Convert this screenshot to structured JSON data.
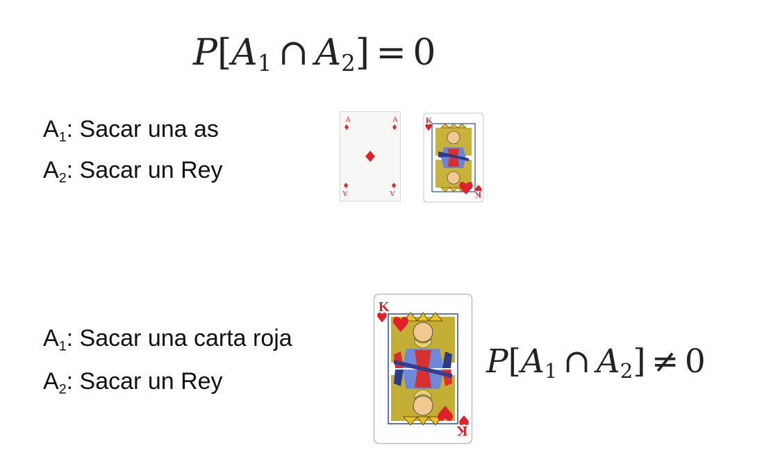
{
  "formulas": {
    "top": {
      "P": "P",
      "lb": "[",
      "A": "A",
      "s1": "1",
      "cap": "∩",
      "s2": "2",
      "rb": "]",
      "rel": "=",
      "rhs": "0"
    },
    "bottom": {
      "P": "P",
      "lb": "[",
      "A": "A",
      "s1": "1",
      "cap": "∩",
      "s2": "2",
      "rb": "]",
      "rel": "≠",
      "rhs": "0"
    }
  },
  "example1": {
    "event1": {
      "letter": "A",
      "sub": "1",
      "text": ": Sacar una as"
    },
    "event2": {
      "letter": "A",
      "sub": "2",
      "text": ": Sacar un Rey"
    }
  },
  "example2": {
    "event1": {
      "letter": "A",
      "sub": "1",
      "text": ": Sacar una carta roja"
    },
    "event2": {
      "letter": "A",
      "sub": "2",
      "text": ": Sacar un Rey"
    }
  },
  "cards": {
    "ace": {
      "rank": "A",
      "suit": "diamonds",
      "color": "#e0202b"
    },
    "king_small": {
      "rank": "K",
      "suit": "hearts",
      "color": "#e0202b"
    },
    "king_large": {
      "rank": "K",
      "suit": "hearts",
      "color": "#e0202b"
    }
  }
}
